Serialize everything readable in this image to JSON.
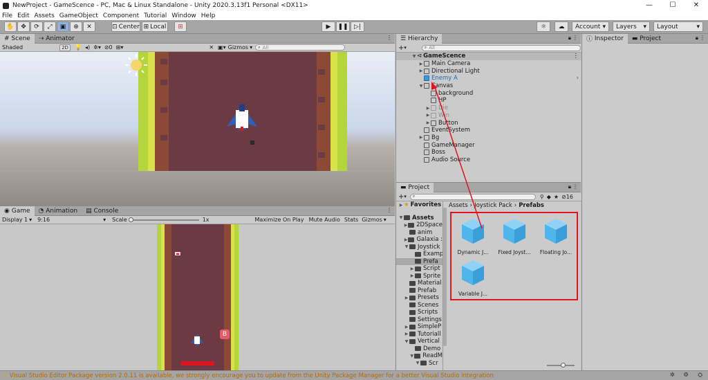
{
  "window": {
    "title": "NewProject - GameScence - PC, Mac & Linux Standalone - Unity 2020.3.13f1 Personal <DX11>",
    "minimize": "—",
    "maximize": "☐",
    "close": "✕"
  },
  "menu": [
    "File",
    "Edit",
    "Assets",
    "GameObject",
    "Component",
    "Tutorial",
    "Window",
    "Help"
  ],
  "toolbar": {
    "center": "Center",
    "local": "Local",
    "account": "Account",
    "layers": "Layers",
    "layout": "Layout"
  },
  "scene": {
    "tabs": [
      "Scene",
      "Animator"
    ],
    "shading": "Shaded",
    "mode_2d": "2D",
    "gizmos": "Gizmos",
    "search_placeholder": "All",
    "fx_count": "0"
  },
  "game": {
    "tabs": [
      "Game",
      "Animation",
      "Console"
    ],
    "display": "Display 1",
    "aspect": "9:16",
    "scale_label": "Scale",
    "scale_value": "1x",
    "maximize": "Maximize On Play",
    "mute": "Mute Audio",
    "stats": "Stats",
    "gizmos": "Gizmos",
    "badge": "B"
  },
  "hierarchy": {
    "tab": "Hierarchy",
    "search_placeholder": "All",
    "add": "+",
    "items": [
      {
        "label": "GameScence",
        "indent": 0,
        "type": "scene",
        "expanded": true
      },
      {
        "label": "Main Camera",
        "indent": 1,
        "type": "object"
      },
      {
        "label": "Directional Light",
        "indent": 1,
        "type": "object"
      },
      {
        "label": "Enemy A",
        "indent": 1,
        "type": "prefab"
      },
      {
        "label": "Canvas",
        "indent": 1,
        "type": "object",
        "expanded": true
      },
      {
        "label": "background",
        "indent": 2,
        "type": "object"
      },
      {
        "label": "HP",
        "indent": 2,
        "type": "object"
      },
      {
        "label": "Die",
        "indent": 2,
        "type": "object",
        "disabled": true
      },
      {
        "label": "Win",
        "indent": 2,
        "type": "object",
        "disabled": true
      },
      {
        "label": "Button",
        "indent": 2,
        "type": "object"
      },
      {
        "label": "EventSystem",
        "indent": 1,
        "type": "object"
      },
      {
        "label": "Bg",
        "indent": 1,
        "type": "object"
      },
      {
        "label": "GameManager",
        "indent": 1,
        "type": "object"
      },
      {
        "label": "Boss",
        "indent": 1,
        "type": "object"
      },
      {
        "label": "Audio Source",
        "indent": 1,
        "type": "object"
      }
    ]
  },
  "inspector": {
    "tabs": [
      "Inspector",
      "Project"
    ]
  },
  "project": {
    "tab": "Project",
    "add": "+",
    "hidden_count": "16",
    "favorites": "Favorites",
    "breadcrumb": [
      "Assets",
      "Joystick Pack",
      "Prefabs"
    ],
    "tree": [
      {
        "label": "Assets",
        "indent": 0,
        "bold": true
      },
      {
        "label": "2DSpace",
        "indent": 1
      },
      {
        "label": "anim",
        "indent": 1
      },
      {
        "label": "Galaxia :",
        "indent": 1
      },
      {
        "label": "Joystick",
        "indent": 1
      },
      {
        "label": "Examp",
        "indent": 2
      },
      {
        "label": "Prefa",
        "indent": 2,
        "selected": true
      },
      {
        "label": "Script",
        "indent": 2
      },
      {
        "label": "Sprite",
        "indent": 2
      },
      {
        "label": "Material",
        "indent": 1
      },
      {
        "label": "Prefab",
        "indent": 1
      },
      {
        "label": "Presets",
        "indent": 1
      },
      {
        "label": "Scenes",
        "indent": 1
      },
      {
        "label": "Scripts",
        "indent": 1
      },
      {
        "label": "Settings",
        "indent": 1
      },
      {
        "label": "SimpleP",
        "indent": 1
      },
      {
        "label": "Tutoriall",
        "indent": 1
      },
      {
        "label": "Vertical",
        "indent": 1
      },
      {
        "label": "Demo",
        "indent": 2
      },
      {
        "label": "ReadM",
        "indent": 2
      },
      {
        "label": "Scr",
        "indent": 3
      }
    ],
    "assets": [
      "Dynamic J...",
      "Fixed Joyst...",
      "Floating Jo...",
      "Variable J..."
    ]
  },
  "status": {
    "message": "Visual Studio Editor Package version 2.0.11 is available, we strongly encourage you to update from the Unity Package Manager for a better Visual Studio integration"
  },
  "colors": {
    "accent_red": "#e0141e",
    "cube_blue": "#4fb6ec",
    "track": "#6b3a42",
    "grass": "#b4d63c"
  }
}
